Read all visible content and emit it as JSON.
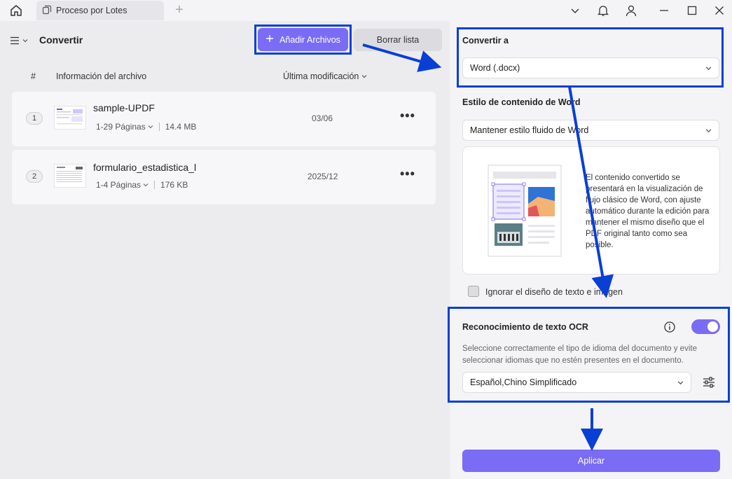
{
  "titlebar": {
    "tab_label": "Proceso por Lotes"
  },
  "left": {
    "title": "Convertir",
    "add_button": "Añadir Archivos",
    "clear_button": "Borrar lista",
    "columns": {
      "num": "#",
      "info": "Información del archivo",
      "modified": "Última modificación"
    },
    "files": [
      {
        "num": "1",
        "name": "sample-UPDF",
        "pages": "1-29 Páginas",
        "size": "14.4 MB",
        "date": "03/06"
      },
      {
        "num": "2",
        "name": "formulario_estadistica_l",
        "pages": "1-4 Páginas",
        "size": "176 KB",
        "date": "2025/12"
      }
    ]
  },
  "right": {
    "convert_to_label": "Convertir a",
    "convert_to_value": "Word (.docx)",
    "style_label": "Estilo de contenido de Word",
    "style_value": "Mantener estilo fluido de Word",
    "style_description": "El contenido convertido se presentará en la visualización de flujo clásico de Word, con ajuste automático durante la edición para mantener el mismo diseño que el PDF original tanto como sea posible.",
    "ignore_layout_label": "Ignorar el diseño de texto e imagen",
    "ocr_label": "Reconocimiento de texto OCR",
    "ocr_description": "Seleccione correctamente el tipo de idioma del documento y evite seleccionar idiomas que no estén presentes en el documento.",
    "ocr_language": "Español,Chino Simplificado",
    "ocr_enabled": true,
    "apply_button": "Aplicar"
  },
  "colors": {
    "accent": "#7b6cf6",
    "highlight": "#0a3fd6"
  }
}
